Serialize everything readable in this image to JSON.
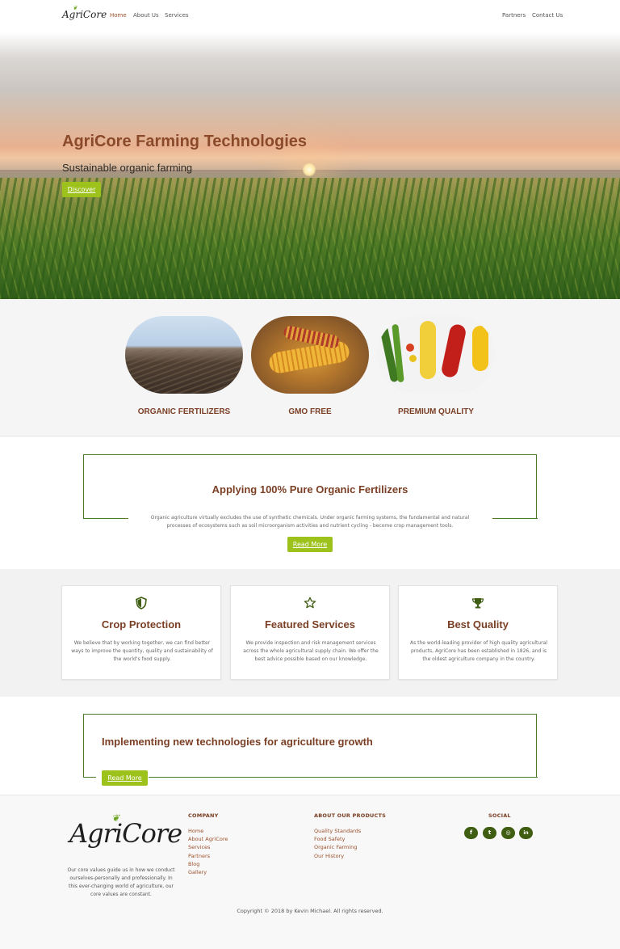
{
  "nav": {
    "logo": "AgriCore",
    "links_left": [
      "Home",
      "About Us",
      "Services"
    ],
    "links_right": [
      "Partners",
      "Contact Us"
    ]
  },
  "hero": {
    "title": "AgriCore Farming Technologies",
    "subtitle": "Sustainable organic farming",
    "button": "Discover"
  },
  "features": [
    {
      "label": "ORGANIC FERTILIZERS"
    },
    {
      "label": "GMO FREE"
    },
    {
      "label": "PREMIUM QUALITY"
    }
  ],
  "organic": {
    "title": "Applying 100% Pure Organic Fertilizers",
    "text": "Organic agriculture virtually excludes the use of synthetic chemicals. Under organic farming systems, the fundamental and natural processes of ecosystems such as soil microorganism activities and nutrient cycling - become crop management tools.",
    "button": "Read More"
  },
  "services": [
    {
      "icon": "shield-icon",
      "title": "Crop Protection",
      "text": "We believe that by working together, we can find better ways to improve the quantity, quality and sustainability of the world's food supply."
    },
    {
      "icon": "star-icon",
      "title": "Featured Services",
      "text": "We provide inspection and risk management services across the whole agricultural supply chain. We offer the best advice possible based on our knowledge."
    },
    {
      "icon": "trophy-icon",
      "title": "Best Quality",
      "text": "As the world-leading provider of high quality agricultural products, AgriCore has been established in 1826, and is the oldest agriculture company in the country."
    }
  ],
  "tech": {
    "title": "Implementing new technologies for agriculture growth",
    "button": "Read More"
  },
  "footer": {
    "logo": "AgriCore",
    "about": "Our core values guide us in how we conduct ourselves-personally and professionally. In this ever-changing world of agriculture, our core values are constant.",
    "company_heading": "COMPANY",
    "company_links": [
      "Home",
      "About AgriCore",
      "Services",
      "Partners",
      "Blog",
      "Gallery"
    ],
    "products_heading": "ABOUT OUR PRODUCTS",
    "products_links": [
      "Quality Standards",
      "Food Safety",
      "Organic Farming",
      "Our History"
    ],
    "social_heading": "SOCIAL",
    "social_icons": [
      "facebook-icon",
      "twitter-icon",
      "instagram-icon",
      "linkedin-icon"
    ],
    "social_glyphs": [
      "f",
      "t",
      "◎",
      "in"
    ],
    "copyright": "Copyright © 2018 by Kevin Michael. All rights reserved."
  },
  "colors": {
    "accent_green": "#9cc21b",
    "dark_green": "#4a7a26",
    "brown": "#7a3f24"
  }
}
